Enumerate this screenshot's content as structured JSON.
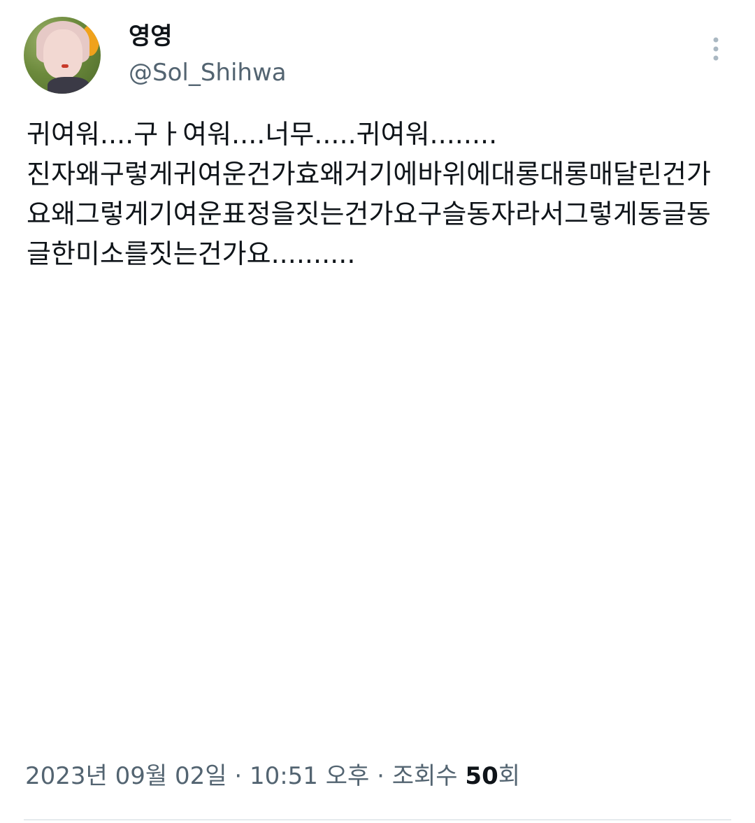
{
  "author": {
    "display_name": "영영",
    "handle": "@Sol_Shihwa"
  },
  "tweet": {
    "text": "귀여워....구ㅏ여워....너무.....귀여워........\n진자왜구렇게귀여운건가효왜거기에바위에대롱대롱매달린건가요왜그렇게기여운표정을짓는건가요구슬동자라서그렇게동글동글한미소를짓는건가요.........."
  },
  "meta": {
    "date": "2023년 09월 02일",
    "separator": "·",
    "time": "10:51 오후",
    "views_label": "조회수",
    "views_count": "50",
    "views_unit": "회"
  },
  "icons": {
    "more": "more-vertical-icon",
    "avatar": "profile-avatar"
  },
  "colors": {
    "text_primary": "#0f1419",
    "text_secondary": "#536471",
    "divider": "#cfd9de",
    "background": "#ffffff"
  }
}
